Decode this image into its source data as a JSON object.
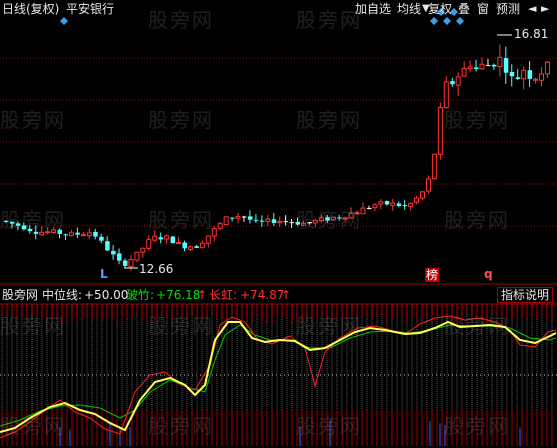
{
  "header": {
    "period": "日线(复权)",
    "stock": "平安银行",
    "tools": [
      "加自选",
      "均线",
      "复权",
      "叠",
      "窗",
      "预测"
    ]
  },
  "watermark": "股旁网",
  "price_chart": {
    "high_label": "16.81",
    "low_label": "12.66",
    "markers": {
      "L": "L",
      "bang": "榜",
      "q": "q"
    }
  },
  "indicator": {
    "name": "股旁网",
    "mid_label": "中位线:",
    "mid_value": "+50.00",
    "pozhu_label": "破竹:",
    "pozhu_value": "+76.18",
    "changhong_label": "长虹:",
    "changhong_value": "+74.87",
    "explain_button": "指标说明"
  },
  "colors": {
    "up": "#ff3232",
    "down": "#54ffff",
    "flat": "#ffffff",
    "grid": "#a00000",
    "yellow": "#ffff54",
    "green": "#00c800",
    "red_line": "#ff2020",
    "diamond": "#3a9fe8"
  }
}
